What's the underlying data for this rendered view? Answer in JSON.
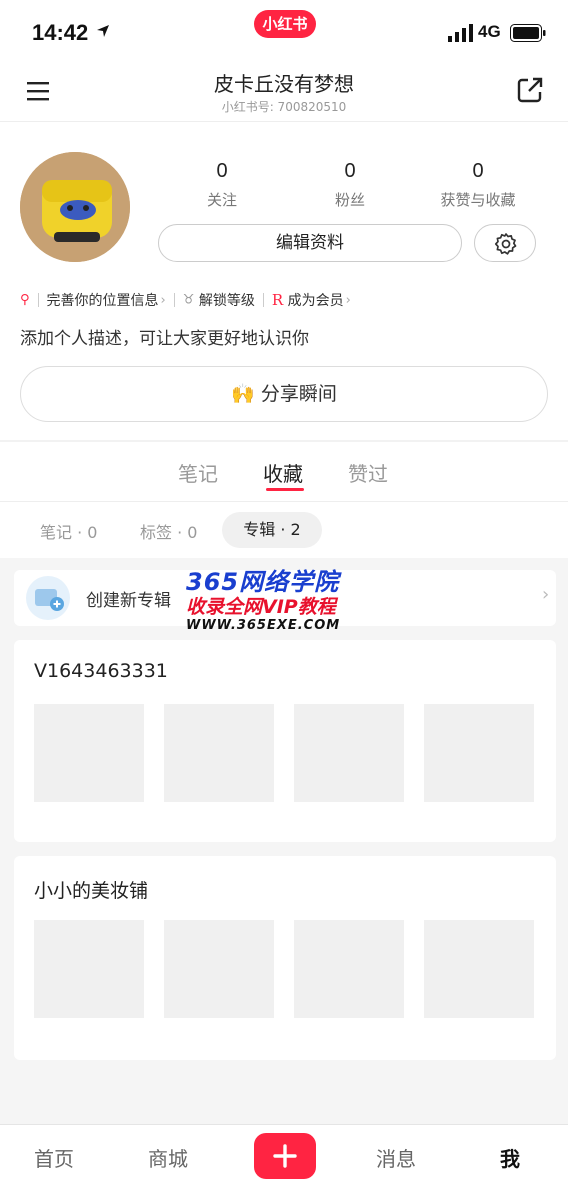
{
  "status_bar": {
    "time": "14:42",
    "app_badge": "小红书",
    "network": "4G"
  },
  "header": {
    "title": "皮卡丘没有梦想",
    "account_id": "小红书号: 700820510"
  },
  "profile": {
    "stats": [
      {
        "value": "0",
        "label": "关注"
      },
      {
        "value": "0",
        "label": "粉丝"
      },
      {
        "value": "0",
        "label": "获赞与收藏"
      }
    ],
    "edit_label": "编辑资料",
    "info_links": [
      "完善你的位置信息",
      "解锁等级",
      "成为会员"
    ],
    "bio": "添加个人描述，可让大家更好地认识你",
    "moment_label": "分享瞬间",
    "moment_emoji": "🙌"
  },
  "tabs": [
    "笔记",
    "收藏",
    "赞过"
  ],
  "active_tab": "收藏",
  "subtabs": [
    "笔记 · 0",
    "标签 · 0",
    "专辑 · 2"
  ],
  "create_album_label": "创建新专辑",
  "albums": [
    {
      "title": "V1643463331"
    },
    {
      "title": "小小的美妆铺"
    }
  ],
  "watermark": {
    "line1": "365网络学院",
    "line2": "收录全网VIP教程",
    "line3": "WWW.365EXE.COM"
  },
  "bottom_nav": [
    "首页",
    "商城",
    "消息",
    "我"
  ],
  "colors": {
    "brand": "#ff2442",
    "bg": "#f5f5f5"
  }
}
